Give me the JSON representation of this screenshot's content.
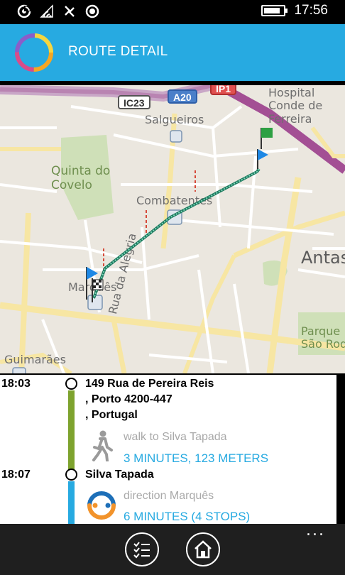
{
  "status_bar": {
    "time": "17:56",
    "battery_level": 0.85,
    "icons": [
      "nfc-icon",
      "wifi-icon",
      "data-sync-icon",
      "location-icon",
      "battery-icon"
    ]
  },
  "header": {
    "title": "ROUTE DETAIL",
    "logo": "app-logo-ring",
    "color": "#27aae1"
  },
  "map": {
    "places": {
      "salgueiros": "Salgueiros",
      "hospital": "Hospital\nConde de\nFerreira",
      "quinta": "Quinta do\nCovelo",
      "combatentes": "Combatentes",
      "antas": "Antas",
      "marques": "Marquês",
      "rua_alegria": "Rua da Alegria",
      "parque": "Parque\nSão Roq",
      "guimaraes": "Guimarães"
    },
    "road_badges": {
      "ic23": "IC23",
      "a20": "A20",
      "ip1": "IP1"
    },
    "route_color": "#2e9a7e"
  },
  "itinerary": {
    "stops": [
      {
        "time": "18:03",
        "name": "149 Rua de Pereira Reis\n, Porto 4200-447\n, Portugal",
        "step": {
          "icon": "walk-icon",
          "description": "walk to Silva Tapada",
          "detail": "3 MINUTES, 123 METERS",
          "line_color": "#7ea32e"
        }
      },
      {
        "time": "18:07",
        "name": "Silva Tapada",
        "step": {
          "icon": "metro-icon",
          "description": "direction Marquês",
          "detail": "6 MINUTES (4 STOPS)",
          "line_color": "#27aae1"
        }
      }
    ],
    "accent": "#27aae1"
  },
  "app_bar": {
    "buttons": [
      "list-icon",
      "home-icon"
    ],
    "more": "..."
  }
}
